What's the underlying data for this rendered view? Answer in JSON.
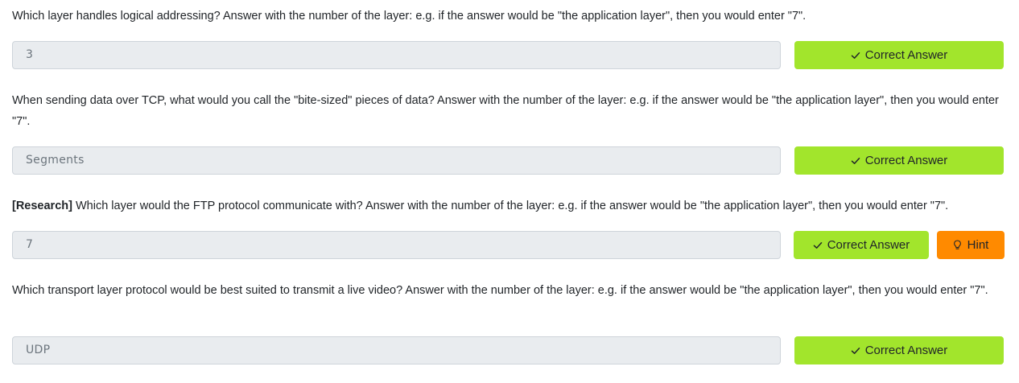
{
  "questions": [
    {
      "prefix": "",
      "text": "Which layer handles logical addressing? Answer with the number of the layer: e.g. if the answer would be \"the application layer\", then you would enter \"7\".",
      "answer": "3",
      "button_label": "Correct Answer",
      "button_icon": "check-icon"
    },
    {
      "prefix": "",
      "text": "When sending data over TCP, what would you call the \"bite-sized\" pieces of data? Answer with the number of the layer: e.g. if the answer would be \"the application layer\", then you would enter \"7\".",
      "answer": "Segments",
      "button_label": "Correct Answer",
      "button_icon": "check-icon"
    },
    {
      "prefix": "[Research]",
      "text": " Which layer would the FTP protocol communicate with? Answer with the number of the layer: e.g. if the answer would be \"the application layer\", then you would enter \"7\".",
      "answer": "7",
      "button_label": "Correct Answer",
      "button_icon": "check-icon",
      "hint_label": "Hint",
      "hint_icon": "lightbulb-icon"
    },
    {
      "prefix": "",
      "text": "Which transport layer protocol would be best suited to transmit a live video? Answer with the number of the layer: e.g. if the answer would be \"the application layer\", then you would enter \"7\".",
      "answer": "UDP",
      "button_label": "Correct Answer",
      "button_icon": "check-icon"
    }
  ],
  "colors": {
    "correct_button": "#a2e52c",
    "hint_button": "#ff8a00",
    "input_background": "#e9ecef",
    "text": "#212529"
  }
}
